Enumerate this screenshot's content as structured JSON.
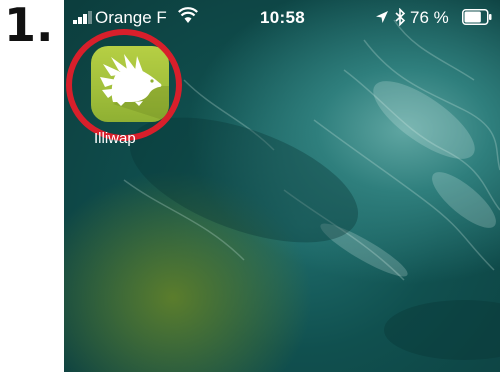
{
  "step": {
    "number": "1."
  },
  "status_bar": {
    "carrier": "Orange F",
    "time": "10:58",
    "battery_percent": "76 %",
    "battery_level": 0.76,
    "signal_strength_bars": 3
  },
  "home_screen": {
    "apps": [
      {
        "label": "Illiwap",
        "icon": "hedgehog-icon",
        "highlighted": true
      }
    ]
  },
  "colors": {
    "highlight_ring": "#d81f2b",
    "app_icon_bg": "#a2c03b",
    "wallpaper": "#10504f"
  }
}
